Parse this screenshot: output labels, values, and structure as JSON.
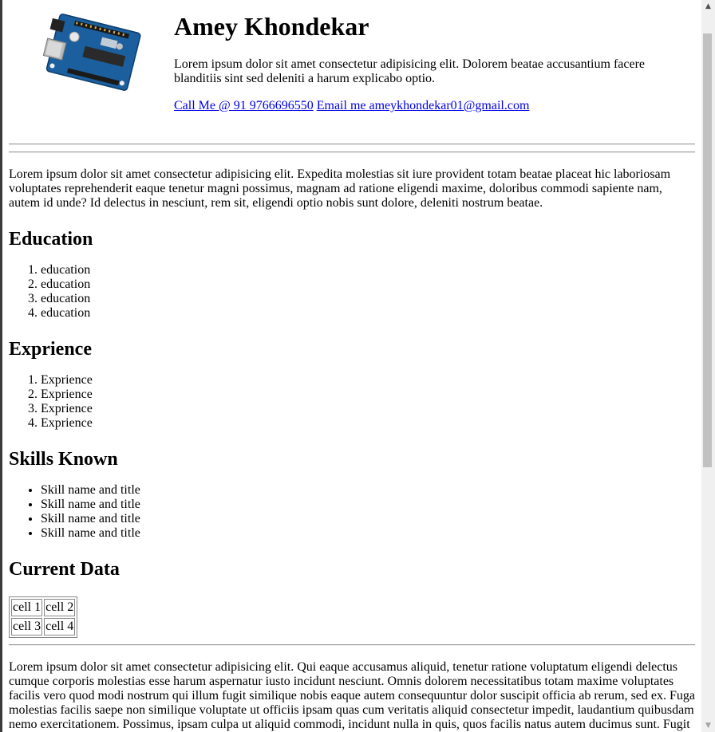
{
  "header": {
    "name": "Amey Khondekar",
    "intro": "Lorem ipsum dolor sit amet consectetur adipisicing elit. Dolorem beatae accusantium facere blanditiis sint sed deleniti a harum explicabo optio.",
    "call_link": "Call Me @ 91 9766696550",
    "email_link": "Email me ameykhondekar01@gmail.com",
    "logo_icon": "arduino-board-icon"
  },
  "about": "Lorem ipsum dolor sit amet consectetur adipisicing elit. Expedita molestias sit iure provident totam beatae placeat hic laboriosam voluptates reprehenderit eaque tenetur magni possimus, magnam ad ratione eligendi maxime, doloribus commodi sapiente nam, autem id unde? Id delectus in nesciunt, rem sit, eligendi optio nobis sunt dolore, deleniti nostrum beatae.",
  "education": {
    "title": "Education",
    "items": [
      "education",
      "education",
      "education",
      "education"
    ]
  },
  "experience": {
    "title": "Exprience",
    "items": [
      "Exprience",
      "Exprience",
      "Exprience",
      "Exprience"
    ]
  },
  "skills": {
    "title": "Skills Known",
    "items": [
      "Skill name and title",
      "Skill name and title",
      "Skill name and title",
      "Skill name and title"
    ]
  },
  "current_data": {
    "title": "Current Data",
    "cells": [
      [
        "cell 1",
        "cell 2"
      ],
      [
        "cell 3",
        "cell 4"
      ]
    ]
  },
  "footer_para": "Lorem ipsum dolor sit amet consectetur adipisicing elit. Qui eaque accusamus aliquid, tenetur ratione voluptatum eligendi delectus cumque corporis molestias esse harum aspernatur iusto incidunt nesciunt. Omnis dolorem necessitatibus totam maxime voluptates facilis vero quod modi nostrum qui illum fugit similique nobis eaque autem consequuntur dolor suscipit officia ab rerum, sed ex. Fuga molestias facilis saepe non similique voluptate ut officiis ipsam quas cum veritatis aliquid consectetur impedit, laudantium quibusdam nemo exercitationem. Possimus, ipsam culpa ut aliquid commodi, incidunt nulla in quis, quos facilis natus autem ducimus sunt. Fugit voluptas nihil, nulla molestiae reprehenderit doloribus, commodi quia natus.",
  "scrollbar": {
    "up_icon": "arrow-up-icon",
    "down_icon": "arrow-down-icon"
  }
}
